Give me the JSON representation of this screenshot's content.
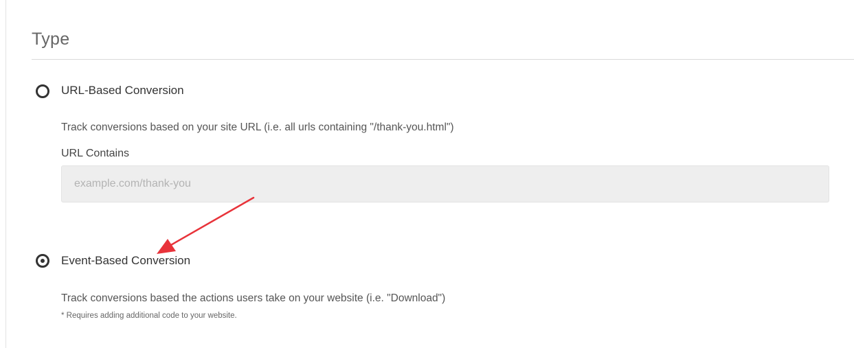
{
  "section": {
    "title": "Type"
  },
  "options": [
    {
      "label": "URL-Based Conversion",
      "checked": false,
      "description": "Track conversions based on your site URL (i.e. all urls containing \"/thank-you.html\")",
      "field_label": "URL Contains",
      "field_value": "",
      "field_placeholder": "example.com/thank-you"
    },
    {
      "label": "Event-Based Conversion",
      "checked": true,
      "description": "Track conversions based the actions users take on your website (i.e. \"Download\")",
      "note": "* Requires adding additional code to your website."
    }
  ],
  "annotation": {
    "arrow_color": "#e8333a",
    "arrow_icon": "red-annotation-arrow"
  },
  "colors": {
    "text_dark": "#333333",
    "input_bg": "#eeeeee"
  }
}
